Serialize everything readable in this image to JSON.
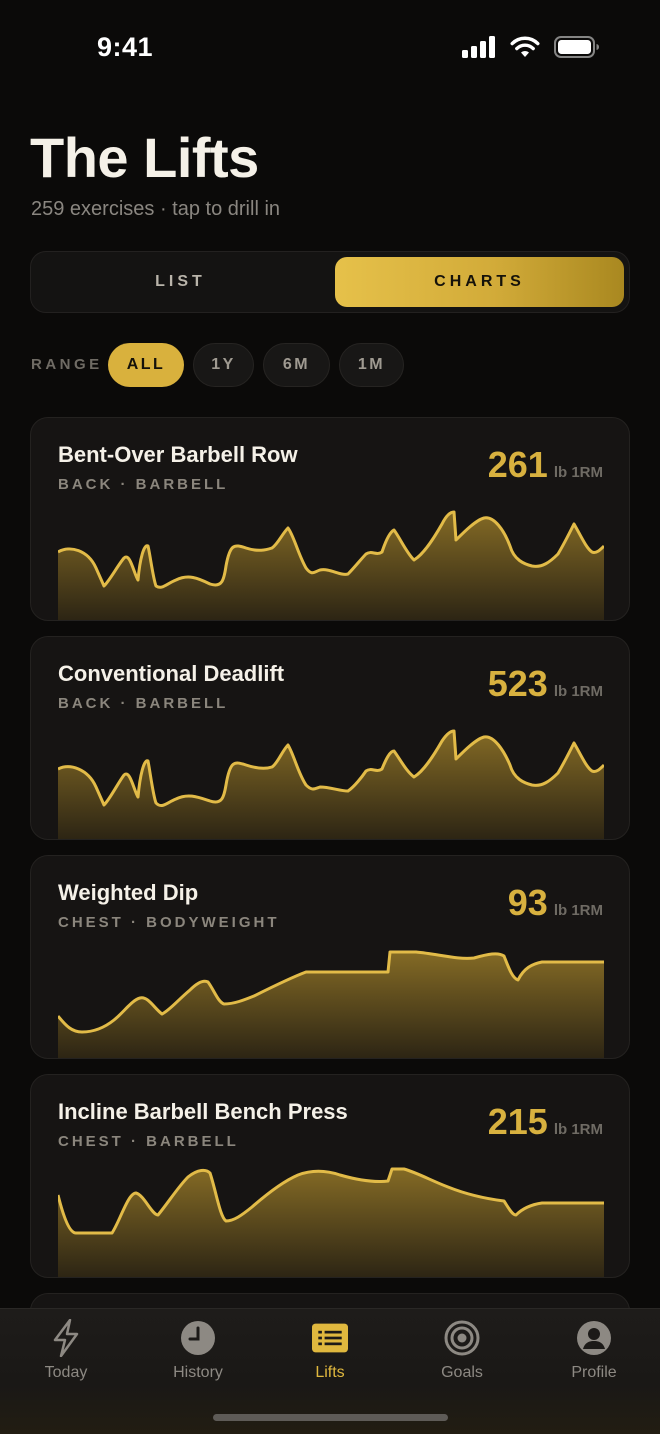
{
  "status_bar": {
    "time": "9:41"
  },
  "header": {
    "title": "The Lifts",
    "subtitle": "259 exercises · tap to drill in"
  },
  "view_toggle": {
    "list_label": "LIST",
    "charts_label": "CHARTS",
    "selected": "CHARTS"
  },
  "range": {
    "label": "RANGE",
    "options": [
      "ALL",
      "1Y",
      "6M",
      "1M"
    ],
    "selected": "ALL"
  },
  "colors": {
    "accent": "#d8b13f",
    "background": "#0b0a09",
    "card": "#161413"
  },
  "cards": [
    {
      "name": "Bent-Over Barbell Row",
      "meta": "BACK · BARBELL",
      "value": "261",
      "unit": "lb 1RM"
    },
    {
      "name": "Conventional Deadlift",
      "meta": "BACK · BARBELL",
      "value": "523",
      "unit": "lb 1RM"
    },
    {
      "name": "Weighted Dip",
      "meta": "CHEST · BODYWEIGHT",
      "value": "93",
      "unit": "lb 1RM"
    },
    {
      "name": "Incline Barbell Bench Press",
      "meta": "CHEST · BARBELL",
      "value": "215",
      "unit": "lb 1RM"
    }
  ],
  "tab_bar": {
    "tabs": [
      {
        "label": "Today",
        "icon": "bolt-icon"
      },
      {
        "label": "History",
        "icon": "clock-icon"
      },
      {
        "label": "Lifts",
        "icon": "list-icon"
      },
      {
        "label": "Goals",
        "icon": "target-icon"
      },
      {
        "label": "Profile",
        "icon": "person-icon"
      }
    ],
    "active": "Lifts"
  }
}
